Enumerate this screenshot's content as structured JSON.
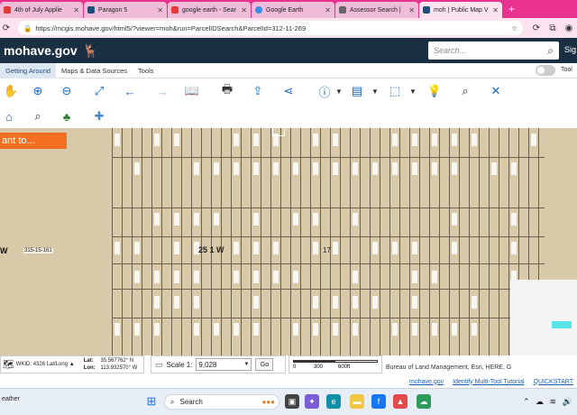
{
  "browser": {
    "tabs": [
      {
        "label": "4th of July Applie",
        "active": false,
        "favicon_color": "#e53935"
      },
      {
        "label": "Paragon 5",
        "active": false,
        "favicon_color": "#1e4f7a"
      },
      {
        "label": "google earth - Sear",
        "active": false,
        "favicon_color": "#e53935"
      },
      {
        "label": "Google Earth",
        "active": false,
        "favicon_color": "#3a8ee6"
      },
      {
        "label": "Assessor Search |",
        "active": false,
        "favicon_color": "#666666"
      },
      {
        "label": "moh | Public Map V",
        "active": true,
        "favicon_color": "#1e4f7a"
      }
    ],
    "new_tab": "+",
    "url": "https://mcgis.mohave.gov/html5/?viewer=moh&run=ParcelIDSearch&ParcelId=312-11-269"
  },
  "header": {
    "logo": "mohave.gov",
    "search_placeholder": "Search...",
    "sign_in": "Sig"
  },
  "menu": {
    "items": [
      "Getting Around",
      "Maps & Data Sources",
      "Tools"
    ],
    "tool_toggle_label": "Tool"
  },
  "map": {
    "i_want_to": "ant to...",
    "township_label": "25 1 W",
    "section_label": "17",
    "left_label": "W",
    "left_parcel_label": "315-15-161"
  },
  "status": {
    "wkid": "WKID: 4326 Lat/Long ▲",
    "lat_label": "Lat:",
    "lat_value": "35.567762° N",
    "lon_label": "Lon:",
    "lon_value": "113.932570° W",
    "scale_label": "Scale 1:",
    "scale_value": "9,028",
    "go": "Go",
    "scalebar_ticks": [
      "0",
      "300",
      "600ft"
    ],
    "attribution": "Bureau of Land Management, Esri, HERE, G",
    "links": [
      "mohave.gov",
      "Identify Multi-Tool Tutorial",
      "QUICKSTART"
    ]
  },
  "taskbar": {
    "weather": "eather",
    "search": "Search"
  },
  "colors": {
    "tab_bar": "#e9318f",
    "header": "#1b2f42",
    "map_bg": "#d8c9a9",
    "i_want_to": "#f37021",
    "tool_icon": "#1565c0"
  }
}
